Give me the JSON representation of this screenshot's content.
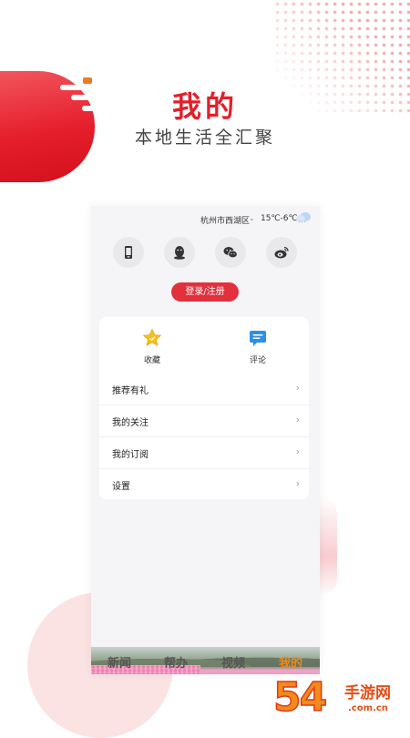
{
  "header": {
    "title": "我的",
    "subtitle": "本地生活全汇聚"
  },
  "topbar": {
    "city": "杭州市西湖区",
    "temperature": "15℃-6℃",
    "weather_icon": "cloudy-icon"
  },
  "social_logins": [
    {
      "name": "phone-icon"
    },
    {
      "name": "qq-icon"
    },
    {
      "name": "wechat-icon"
    },
    {
      "name": "weibo-icon"
    }
  ],
  "login_button": "登录/注册",
  "quick_actions": [
    {
      "label": "收藏",
      "icon": "star-icon"
    },
    {
      "label": "评论",
      "icon": "comment-icon"
    }
  ],
  "menu": [
    {
      "label": "推荐有礼"
    },
    {
      "label": "我的关注"
    },
    {
      "label": "我的订阅"
    },
    {
      "label": "设置"
    }
  ],
  "tabs": [
    {
      "label": "新闻",
      "active": false
    },
    {
      "label": "帮办",
      "active": false
    },
    {
      "label": "视频",
      "active": false
    },
    {
      "label": "我的",
      "active": true
    }
  ],
  "watermark": {
    "number": "54",
    "text": "手游网",
    "url": ".com.cn"
  },
  "colors": {
    "accent": "#e2202c",
    "active_tab": "#ef8a1a"
  }
}
